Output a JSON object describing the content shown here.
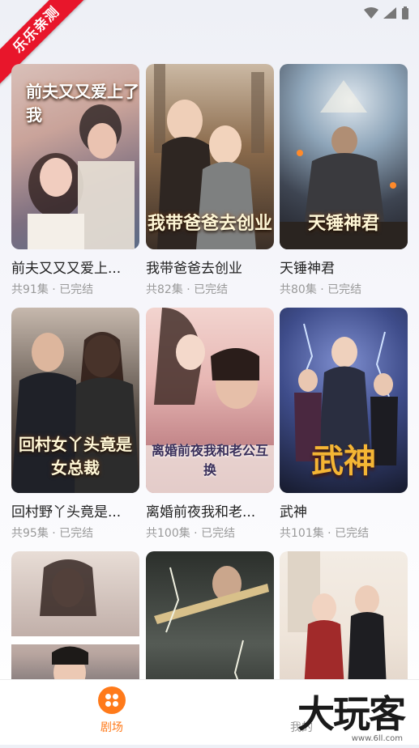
{
  "ribbon": "乐乐亲测",
  "dramas": [
    {
      "title": "前夫又又又爱上...",
      "meta": "共91集 · 已完结",
      "poster_text": "前夫又又爱上了我",
      "colors": [
        "#c9a39a",
        "#5b6b86"
      ]
    },
    {
      "title": "我带爸爸去创业",
      "meta": "共82集 · 已完结",
      "poster_text": "我带爸爸去创业",
      "colors": [
        "#8b6b4c",
        "#3b2f27"
      ]
    },
    {
      "title": "天锤神君",
      "meta": "共80集 · 已完结",
      "poster_text": "天锤神君",
      "colors": [
        "#6f8aa3",
        "#2a2a30"
      ]
    },
    {
      "title": "回村野丫头竟是...",
      "meta": "共95集 · 已完结",
      "poster_text": "回村女丫头竟是女总裁",
      "colors": [
        "#5a5048",
        "#2b2220"
      ]
    },
    {
      "title": "离婚前夜我和老...",
      "meta": "共100集 · 已完结",
      "poster_text": "离婚前夜我和老公互换",
      "colors": [
        "#e7b6b3",
        "#a8626a"
      ]
    },
    {
      "title": "武神",
      "meta": "共101集 · 已完结",
      "poster_text": "武神",
      "colors": [
        "#3e4c8a",
        "#161a2c"
      ]
    },
    {
      "title": "",
      "meta": "",
      "poster_text": "",
      "colors": [
        "#b9a6a0",
        "#2f3440"
      ]
    },
    {
      "title": "",
      "meta": "",
      "poster_text": "",
      "colors": [
        "#555b55",
        "#1b1e1b"
      ]
    },
    {
      "title": "",
      "meta": "",
      "poster_text": "",
      "colors": [
        "#efe5da",
        "#a14a44"
      ]
    }
  ],
  "nav": {
    "theater": "剧场",
    "mine": "我的"
  },
  "watermark": "大玩客",
  "watermark_sub": "www.6ll.com"
}
